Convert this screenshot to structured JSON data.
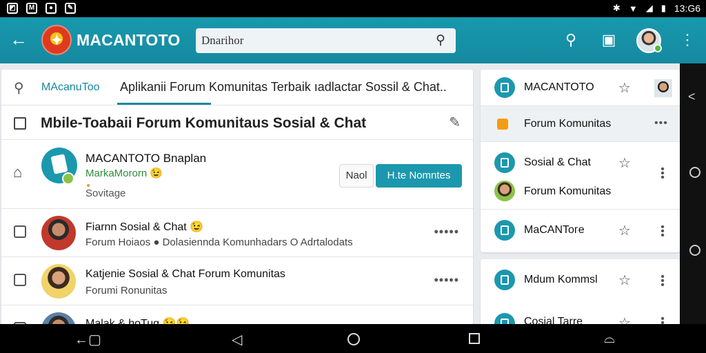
{
  "status_bar": {
    "time": "13:G6"
  },
  "app_bar": {
    "brand": "MACANTOTO",
    "search_placeholder": "Dnarihor",
    "colors": {
      "primary": "#1799ad",
      "accent": "#1c98ae"
    }
  },
  "tabs": {
    "brand_tab": "MAcanuToo",
    "main_tab": "Aplikanii Forum  Komunitas  Terbaik  ıadlactar Sossil & Chat.."
  },
  "page_title": "Mbile-Toabaii Forum Komunitaus Sosial & Chat",
  "featured": {
    "title": "MACANTOTO  Bnaplan",
    "subtitle": "MarkaMororn 😉",
    "small": "Sovitage",
    "next_label": "Naol",
    "join_label": "H.te Nomntes"
  },
  "posts": [
    {
      "title": "Fiarnn Sosial & Chat 😉",
      "subtitle": "Forum Hoiaos  ● Dolasiennda Komunhadars O Adrtalodats"
    },
    {
      "title": "Katjenie Sosial & Chat Forum Komunitas",
      "subtitle": "Forumi Ronunitas"
    },
    {
      "title": "Malak & hoTug 😉😉",
      "subtitle": ""
    }
  ],
  "right_panel": {
    "items": [
      {
        "label": "MACANTOTO"
      },
      {
        "label": "Forum Komunitas"
      },
      {
        "label": "Sosial & Chat"
      },
      {
        "label": "Forum Komunitas"
      },
      {
        "label": "MaCANToгe"
      }
    ],
    "items2": [
      {
        "label": "Mdum Kommsl"
      },
      {
        "label": "Cosial Tarre"
      }
    ]
  },
  "icons": [
    "back-arrow-icon",
    "search-icon",
    "bag-icon",
    "more-vert-icon",
    "star-icon",
    "edit-icon",
    "home-icon",
    "checkbox-icon"
  ]
}
